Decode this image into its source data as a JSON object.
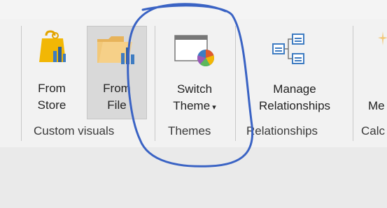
{
  "ribbon": {
    "custom_visuals": {
      "group_label": "Custom visuals",
      "from_store": {
        "line1": "From",
        "line2": "Store",
        "icon": "store-bag-icon"
      },
      "from_file": {
        "line1": "From",
        "line2": "File",
        "icon": "folder-chart-icon"
      }
    },
    "themes": {
      "group_label": "Themes",
      "switch_theme": {
        "line1": "Switch",
        "line2": "Theme",
        "dropdown": "▾",
        "icon": "switch-theme-icon"
      }
    },
    "relationships": {
      "group_label": "Relationships",
      "manage_relationships": {
        "line1": "Manage",
        "line2": "Relationships",
        "icon": "manage-relationships-icon"
      }
    },
    "calculations": {
      "group_label": "Calc",
      "next_button_partial": "Me"
    }
  },
  "colors": {
    "ribbon_bg": "#f2f2f2",
    "hover_bg": "#d9d9d9",
    "annotation_stroke": "#3a63c4",
    "store_yellow": "#f2b705",
    "icon_blue": "#3e7cc2"
  }
}
